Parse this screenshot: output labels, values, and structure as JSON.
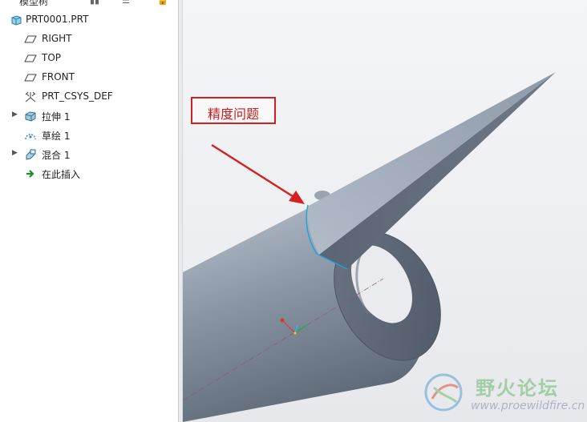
{
  "tree": {
    "header_title": "模型树",
    "items": [
      {
        "label": "PRT0001.PRT",
        "icon": "part-icon",
        "expander": false
      },
      {
        "label": "RIGHT",
        "icon": "datum-plane-icon",
        "expander": false
      },
      {
        "label": "TOP",
        "icon": "datum-plane-icon",
        "expander": false
      },
      {
        "label": "FRONT",
        "icon": "datum-plane-icon",
        "expander": false
      },
      {
        "label": "PRT_CSYS_DEF",
        "icon": "coordinate-system-icon",
        "expander": false
      },
      {
        "label": "拉伸 1",
        "icon": "extrude-icon",
        "expander": true
      },
      {
        "label": "草绘 1",
        "icon": "sketch-icon",
        "expander": false
      },
      {
        "label": "混合 1",
        "icon": "blend-icon",
        "expander": true
      },
      {
        "label": "在此插入",
        "icon": "insert-here-icon",
        "expander": false
      }
    ]
  },
  "viewport": {
    "callout_text": "精度问题",
    "accent_red": "#d42020",
    "model_color": "#7d8896"
  },
  "watermark": {
    "name": "野火论坛",
    "url": "www.proewildfire.cn"
  }
}
